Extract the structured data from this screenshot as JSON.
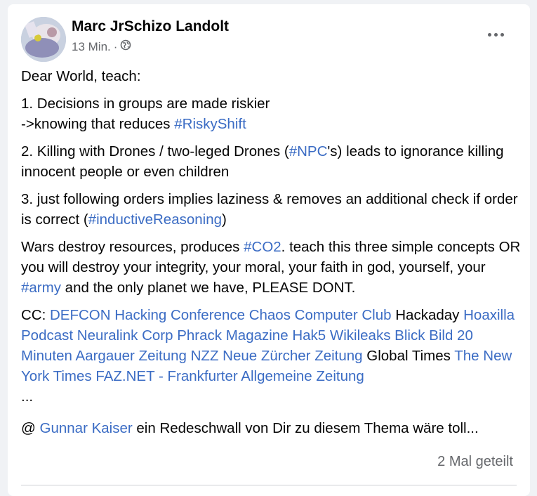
{
  "post": {
    "author": "Marc JrSchizo Landolt",
    "time": "13 Min.",
    "separator": "·",
    "privacy_icon": "globe-icon",
    "more_icon": "more-horizontal-icon",
    "intro": "Dear World, teach:",
    "point1": {
      "line1": "1. Decisions in groups are made riskier",
      "line2": "->knowing that reduces ",
      "hashtag": "#RiskyShift"
    },
    "point2": {
      "pre": "2. Killing with Drones / two-leged Drones (",
      "hashtag": "#NPC",
      "post": "'s) leads to ignorance killing innocent people or even children"
    },
    "point3": {
      "pre": "3. just following orders implies laziness & removes an additional check if order is correct (",
      "hashtag": "#inductiveReasoning",
      "post": ")"
    },
    "wars": {
      "pre": "Wars destroy resources, produces ",
      "hashtag1": "#CO2",
      "mid": ". teach this three simple concepts OR you will destroy your integrity, your moral, your faith in god, yourself, your ",
      "hashtag2": "#army",
      "post": " and the only planet we have, PLEASE DONT."
    },
    "cc": {
      "label": "CC: ",
      "defcon": "DEFCON Hacking Conference",
      "ccc": "Chaos Computer Club",
      "hackaday": "Hackaday",
      "hoaxilla": "Hoaxilla Podcast",
      "neuralink": "Neuralink Corp",
      "phrack": "Phrack Magazine",
      "hak5": "Hak5",
      "wikileaks": "Wikileaks",
      "blick": "Blick",
      "bild": "Bild",
      "min20": "20 Minuten",
      "aargauer": "Aargauer Zeitung",
      "nzz": "NZZ Neue Zürcher Zeitung",
      "globaltimes": "Global Times",
      "nyt": "The New York Times",
      "faz": "FAZ.NET - Frankfurter Allgemeine Zeitung",
      "ellipsis": "..."
    },
    "mention": {
      "pre": "@ ",
      "name": "Gunnar Kaiser",
      "post": " ein Redeschwall von Dir zu diesem Thema wäre toll..."
    },
    "shares": "2 Mal geteilt",
    "link_color": "#3b6cc4"
  }
}
